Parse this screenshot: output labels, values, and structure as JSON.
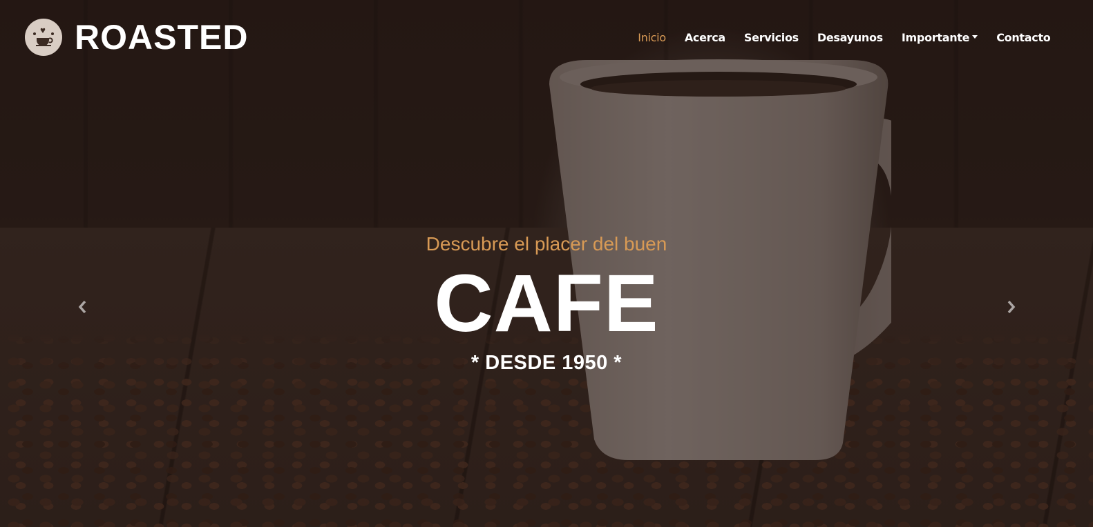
{
  "brand": {
    "name": "ROASTED",
    "logo_icon": "coffee-cup-logo-icon"
  },
  "nav": {
    "items": [
      {
        "label": "Inicio",
        "active": true
      },
      {
        "label": "Acerca",
        "active": false
      },
      {
        "label": "Servicios",
        "active": false
      },
      {
        "label": "Desayunos",
        "active": false
      },
      {
        "label": "Importante",
        "active": false,
        "dropdown": true
      },
      {
        "label": "Contacto",
        "active": false
      }
    ]
  },
  "hero": {
    "subtitle": "Descubre el placer del buen",
    "headline": "CAFE",
    "tagline": "* DESDE 1950 *"
  },
  "carousel": {
    "prev_icon": "chevron-left-icon",
    "next_icon": "chevron-right-icon"
  },
  "colors": {
    "accent": "#d89a55",
    "text": "#ffffff",
    "background": "#2d201c"
  }
}
